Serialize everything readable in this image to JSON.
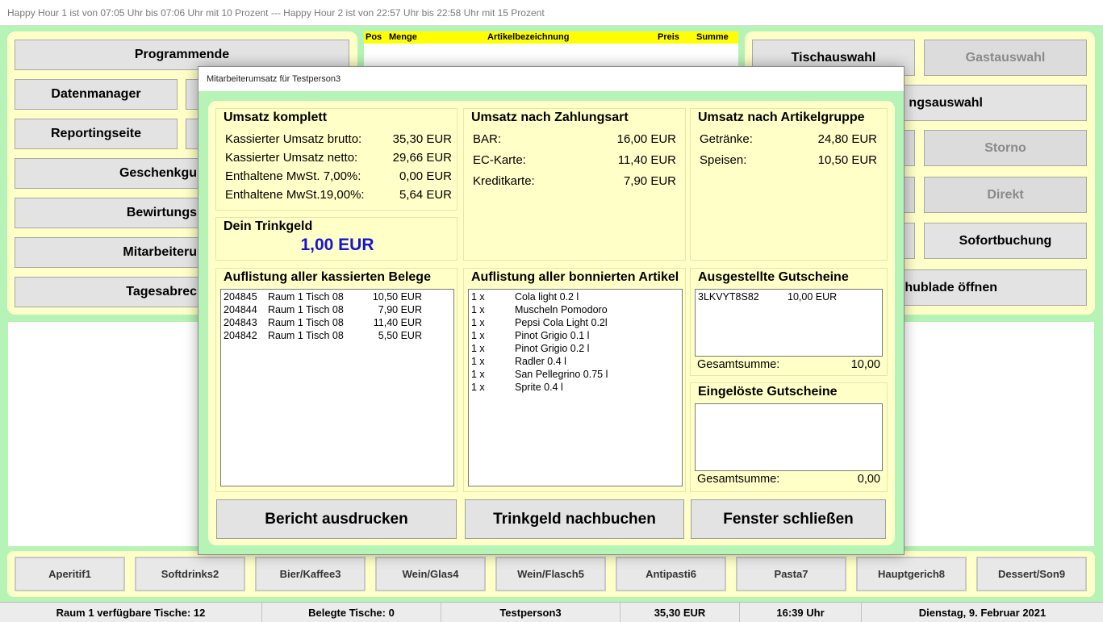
{
  "window": {
    "title": "Happy Hour 1 ist von 07:05 Uhr bis 07:06 Uhr mit 10 Prozent --- Happy Hour 2 ist von 22:57 Uhr bis 22:58 Uhr mit 15 Prozent"
  },
  "left_menu": {
    "programmende": "Programmende",
    "datenmanager": "Datenmanager",
    "reportingseite": "Reportingseite",
    "geschenkgutscheine": "Geschenkgu",
    "bewirtung": "Bewirtungs",
    "mitarbeiter": "Mitarbeiteru",
    "tagesabrechnung": "Tagesabrec"
  },
  "order_table": {
    "headers": [
      "Pos",
      "Menge",
      "Artikelbezeichnung",
      "Preis",
      "Summe"
    ]
  },
  "right_menu": {
    "tischauswahl": "Tischauswahl",
    "gastauswahl": "Gastauswahl",
    "zahlungsauswahl": "ngsauswahl",
    "storno": "Storno",
    "direkt": "Direkt",
    "sofortbuchung": "Sofortbuchung",
    "schublade": "hublade öffnen"
  },
  "categories": [
    "Aperitif1",
    "Softdrinks2",
    "Bier/Kaffee3",
    "Wein/Glas4",
    "Wein/Flasch5",
    "Antipasti6",
    "Pasta7",
    "Hauptgerich8",
    "Dessert/Son9"
  ],
  "status_bar": {
    "tables_free": "Raum 1 verfügbare Tische: 12",
    "tables_occupied": "Belegte Tische: 0",
    "user": "Testperson3",
    "total": "35,30 EUR",
    "time": "16:39 Uhr",
    "date": "Dienstag, 9. Februar 2021"
  },
  "dialog": {
    "title": "Mitarbeiterumsatz für Testperson3",
    "umsatz_komplett": {
      "title": "Umsatz komplett",
      "rows": [
        {
          "label": "Kassierter Umsatz brutto:",
          "value": "35,30 EUR"
        },
        {
          "label": "Kassierter Umsatz netto:",
          "value": "29,66 EUR"
        },
        {
          "label": "Enthaltene MwSt. 7,00%:",
          "value": "0,00 EUR"
        },
        {
          "label": "Enthaltene MwSt.19,00%:",
          "value": "5,64 EUR"
        }
      ]
    },
    "umsatz_zahlungsart": {
      "title": "Umsatz nach Zahlungsart",
      "rows": [
        {
          "label": "BAR:",
          "value": "16,00 EUR"
        },
        {
          "label": "EC-Karte:",
          "value": "11,40 EUR"
        },
        {
          "label": "Kreditkarte:",
          "value": "7,90 EUR"
        }
      ]
    },
    "umsatz_artikelgruppe": {
      "title": "Umsatz nach Artikelgruppe",
      "rows": [
        {
          "label": "Getränke:",
          "value": "24,80 EUR"
        },
        {
          "label": "Speisen:",
          "value": "10,50 EUR"
        }
      ]
    },
    "trinkgeld": {
      "title": "Dein Trinkgeld",
      "value": "1,00 EUR"
    },
    "belege": {
      "title": "Auflistung aller kassierten Belege",
      "items": [
        {
          "nr": "204845",
          "ort": "Raum 1 Tisch 08",
          "betrag": "10,50 EUR"
        },
        {
          "nr": "204844",
          "ort": "Raum 1 Tisch 08",
          "betrag": "7,90 EUR"
        },
        {
          "nr": "204843",
          "ort": "Raum 1 Tisch 08",
          "betrag": "11,40 EUR"
        },
        {
          "nr": "204842",
          "ort": "Raum 1 Tisch 08",
          "betrag": "5,50 EUR"
        }
      ]
    },
    "artikel": {
      "title": "Auflistung aller bonnierten Artikel",
      "items": [
        {
          "menge": "1 x",
          "name": "Cola light 0.2 l"
        },
        {
          "menge": "1 x",
          "name": "Muscheln Pomodoro"
        },
        {
          "menge": "1 x",
          "name": "Pepsi Cola Light 0.2l"
        },
        {
          "menge": "1 x",
          "name": "Pinot Grigio 0.1 l"
        },
        {
          "menge": "1 x",
          "name": "Pinot Grigio 0.2 l"
        },
        {
          "menge": "1 x",
          "name": "Radler 0.4 l"
        },
        {
          "menge": "1 x",
          "name": "San Pellegrino 0.75 l"
        },
        {
          "menge": "1 x",
          "name": "Sprite 0.4 l"
        }
      ]
    },
    "ausgestellte_gutscheine": {
      "title": "Ausgestellte Gutscheine",
      "items": [
        {
          "code": "3LKVYT8S82",
          "betrag": "10,00 EUR"
        }
      ],
      "total_label": "Gesamtsumme:",
      "total_value": "10,00"
    },
    "eingeloeste_gutscheine": {
      "title": "Eingelöste Gutscheine",
      "total_label": "Gesamtsumme:",
      "total_value": "0,00"
    },
    "buttons": {
      "print": "Bericht ausdrucken",
      "tip": "Trinkgeld nachbuchen",
      "close": "Fenster schließen"
    }
  }
}
